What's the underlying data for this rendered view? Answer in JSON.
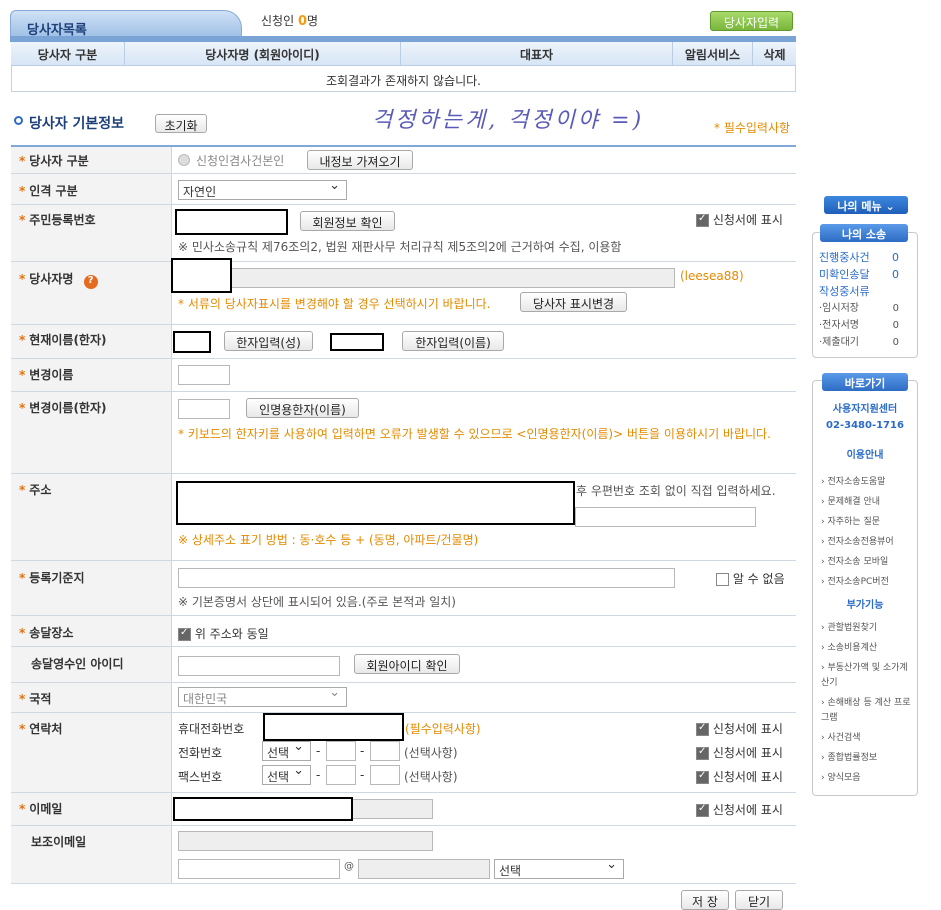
{
  "list": {
    "tab": "당사자목록",
    "count_label": "신청인",
    "count": "0",
    "count_unit": "명",
    "add_button": "당사자입력",
    "headers": [
      "당사자 구분",
      "당사자명 (회원아이디)",
      "대표자",
      "알림서비스",
      "삭제"
    ],
    "empty": "조회결과가 존재하지 않습니다."
  },
  "form": {
    "title": "당사자 기본정보",
    "reset": "초기화",
    "handwriting": "걱정하는게, 걱정이야 =)",
    "required_note": "* 필수입력사항",
    "type_label": "당사자 구분",
    "type_value": "신청인겸사건본인",
    "my_info_button": "내정보 가져오기",
    "person_label": "인격 구분",
    "person_value": "자연인",
    "rrn_label": "주민등록번호",
    "rrn_button": "회원정보 확인",
    "show_on_app": "신청서에 표시",
    "rrn_note": "※ 민사소송규칙 제76조의2, 법원 재판사무 처리규칙 제5조의2에 근거하여 수집, 이용함",
    "name_label": "당사자명",
    "name_id": "(leesea88)",
    "name_note": "* 서류의 당사자표시를 변경해야 할 경우 선택하시기 바랍니다.",
    "name_change_button": "당사자 표시변경",
    "hanja_label": "현재이름(한자)",
    "hanja_surname_button": "한자입력(성)",
    "hanja_name_button": "한자입력(이름)",
    "changed_label": "변경이름",
    "changed_hanja_label": "변경이름(한자)",
    "changed_hanja_button": "인명용한자(이름)",
    "changed_hanja_note": "* 키보드의 한자키를 사용하여 입력하면 오류가 발생할 수 있으므로 <인명용한자(이름)> 버튼을 이용하시기 바랍니다.",
    "address_label": "주소",
    "address_hint": "후 우편번호 조회 없이 직접 입력하세요.",
    "address_note": "※ 상세주소 표기 방법 : 동·호수 등 + (동명, 아파트/건물명)",
    "registry_label": "등록기준지",
    "unknown": "알 수 없음",
    "registry_note": "※ 기본증명서 상단에 표시되어 있음.(주로 본적과 일치)",
    "delivery_label": "송달장소",
    "same_address": "위 주소와 동일",
    "recipient_label": "송달영수인 아이디",
    "member_id_button": "회원아이디 확인",
    "nation_label": "국적",
    "nation_value": "대한민국",
    "contact_label": "연락처",
    "mobile_label": "휴대전화번호",
    "mobile_required": "(필수입력사항)",
    "phone_label": "전화번호",
    "fax_label": "팩스번호",
    "select": "선택",
    "optional": "(선택사항)",
    "dash": "-",
    "email_label": "이메일",
    "sub_email_label": "보조이메일",
    "at": "@",
    "domain_select": "선택",
    "save": "저 장",
    "close": "닫기"
  },
  "side": {
    "menu_button": "나의 메뉴 ⌄",
    "lawsuit_head": "나의 소송",
    "lawsuit": [
      {
        "label": "진행중사건",
        "count": "0"
      },
      {
        "label": "미확인송달",
        "count": "0"
      },
      {
        "label": "작성중서류",
        "count": ""
      }
    ],
    "drafts": [
      {
        "label": "·임시저장",
        "count": "0"
      },
      {
        "label": "·전자서명",
        "count": "0"
      },
      {
        "label": "·제출대기",
        "count": "0"
      }
    ],
    "shortcut_head": "바로가기",
    "support": "사용자지원센터",
    "support_phone": "02-3480-1716",
    "guide_head": "이용안내",
    "guide": [
      "전자소송도움말",
      "문제해결 안내",
      "자주하는 질문",
      "전자소송전용뷰어",
      "전자소송 모바일",
      "전자소송PC버전"
    ],
    "extra_head": "부가기능",
    "extra": [
      "관할법원찾기",
      "소송비용계산",
      "부동산가액 및 소가계산기",
      "손해배상 등 계산 프로그램",
      "사건검색",
      "종합법률정보",
      "양식모음"
    ]
  }
}
